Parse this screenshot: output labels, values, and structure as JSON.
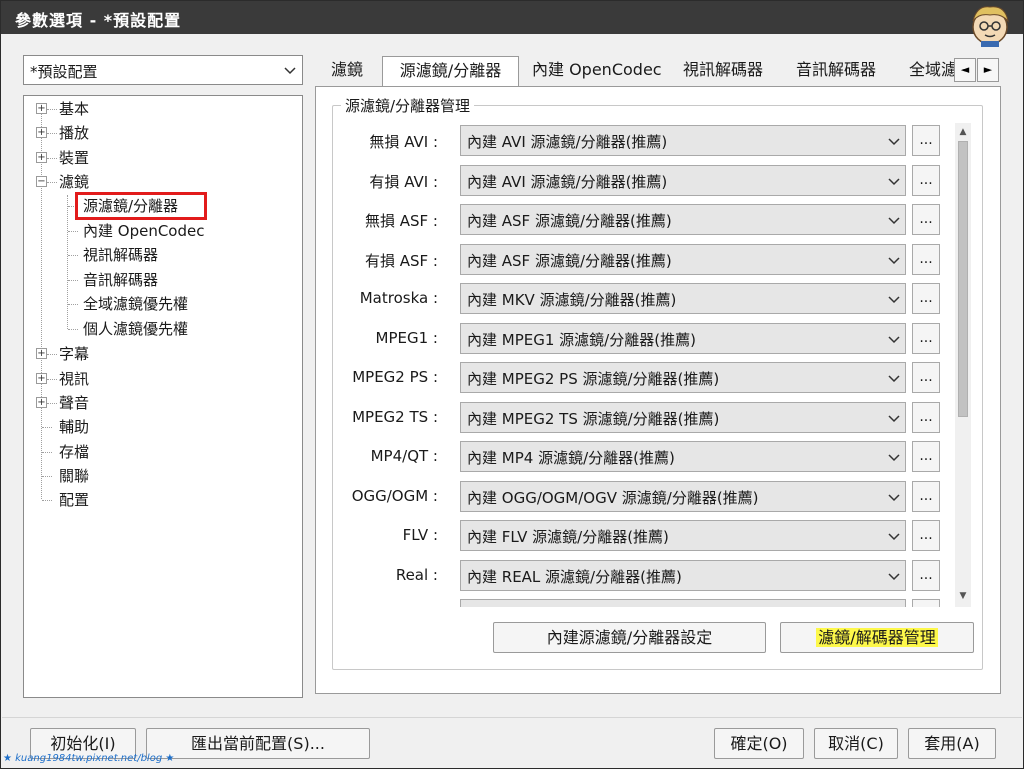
{
  "window": {
    "title": "參數選項 - *預設配置"
  },
  "profile": {
    "selected": "*預設配置"
  },
  "tree": {
    "items": [
      {
        "label": "基本",
        "expander": "+"
      },
      {
        "label": "播放",
        "expander": "+"
      },
      {
        "label": "裝置",
        "expander": "+"
      },
      {
        "label": "濾鏡",
        "expander": "−"
      },
      {
        "label": "源濾鏡/分離器"
      },
      {
        "label": "內建 OpenCodec"
      },
      {
        "label": "視訊解碼器"
      },
      {
        "label": "音訊解碼器"
      },
      {
        "label": "全域濾鏡優先權"
      },
      {
        "label": "個人濾鏡優先權"
      },
      {
        "label": "字幕",
        "expander": "+"
      },
      {
        "label": "視訊",
        "expander": "+"
      },
      {
        "label": "聲音",
        "expander": "+"
      },
      {
        "label": "輔助"
      },
      {
        "label": "存檔"
      },
      {
        "label": "關聯"
      },
      {
        "label": "配置"
      }
    ]
  },
  "tabs": [
    {
      "label": "濾鏡"
    },
    {
      "label": "源濾鏡/分離器"
    },
    {
      "label": "內建 OpenCodec"
    },
    {
      "label": "視訊解碼器"
    },
    {
      "label": "音訊解碼器"
    },
    {
      "label": "全域濾"
    }
  ],
  "tab_scroll": {
    "left": "◄",
    "right": "►"
  },
  "group": {
    "title": "源濾鏡/分離器管理"
  },
  "rows": [
    {
      "label": "無損 AVI :",
      "value": "內建 AVI 源濾鏡/分離器(推薦)"
    },
    {
      "label": "有損 AVI :",
      "value": "內建 AVI 源濾鏡/分離器(推薦)"
    },
    {
      "label": "無損 ASF :",
      "value": "內建 ASF 源濾鏡/分離器(推薦)"
    },
    {
      "label": "有損 ASF :",
      "value": "內建 ASF 源濾鏡/分離器(推薦)"
    },
    {
      "label": "Matroska :",
      "value": "內建 MKV 源濾鏡/分離器(推薦)"
    },
    {
      "label": "MPEG1 :",
      "value": "內建 MPEG1 源濾鏡/分離器(推薦)"
    },
    {
      "label": "MPEG2 PS :",
      "value": "內建 MPEG2 PS 源濾鏡/分離器(推薦)"
    },
    {
      "label": "MPEG2 TS :",
      "value": "內建 MPEG2 TS 源濾鏡/分離器(推薦)"
    },
    {
      "label": "MP4/QT :",
      "value": "內建 MP4 源濾鏡/分離器(推薦)"
    },
    {
      "label": "OGG/OGM :",
      "value": "內建 OGG/OGM/OGV 源濾鏡/分離器(推薦)"
    },
    {
      "label": "FLV :",
      "value": "內建 FLV 源濾鏡/分離器(推薦)"
    },
    {
      "label": "Real :",
      "value": "內建 REAL 源濾鏡/分離器(推薦)"
    }
  ],
  "more_label": "...",
  "buttons": {
    "builtin_settings": "內建源濾鏡/分離器設定",
    "filter_manager": "濾鏡/解碼器管理",
    "init": "初始化(I)",
    "export": "匯出當前配置(S)...",
    "ok": "確定(O)",
    "cancel": "取消(C)",
    "apply": "套用(A)"
  },
  "watermark": "★ kuang1984tw.pixnet.net/blog ★",
  "colors": {
    "highlight": "#fdf84a",
    "selection_outline": "#e21b1b",
    "titlebar": "#3a3a3a"
  }
}
